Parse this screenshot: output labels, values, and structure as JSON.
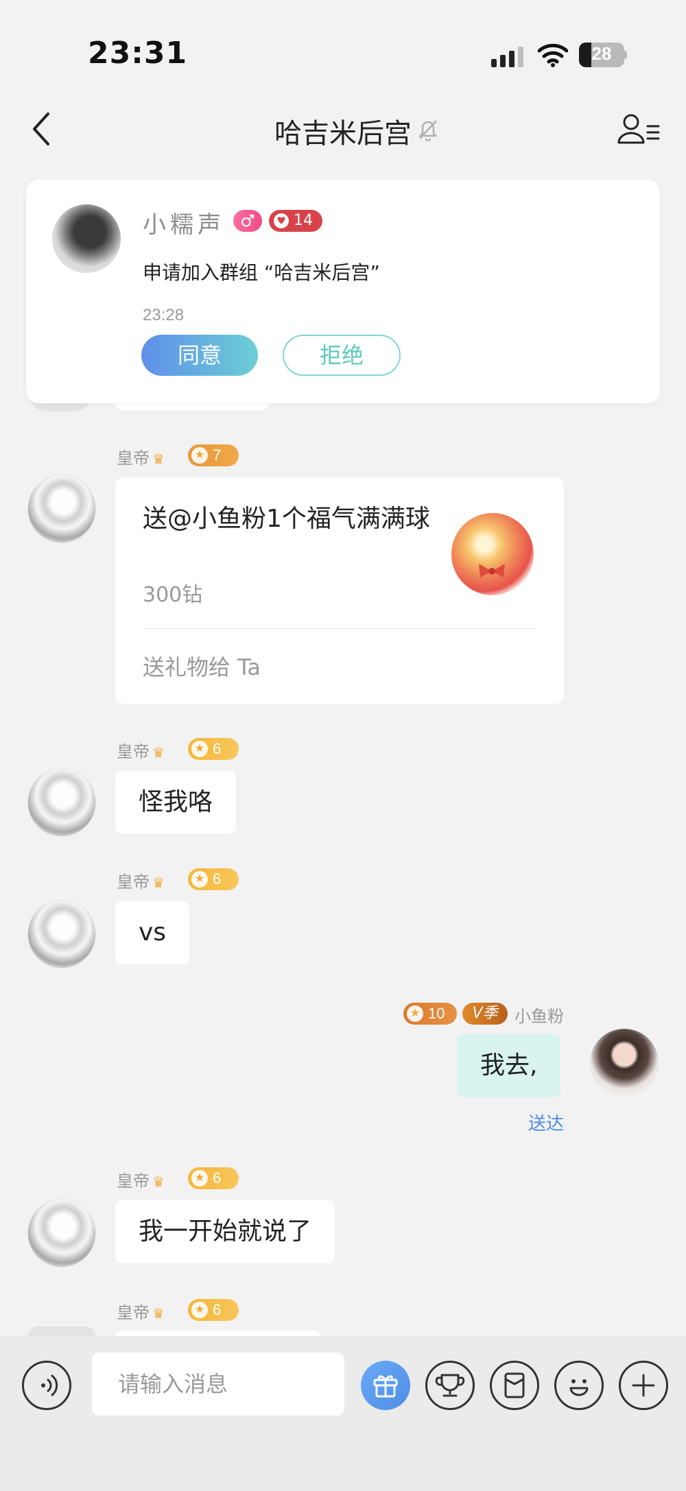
{
  "status_bar": {
    "time": "23:31",
    "battery": "28"
  },
  "nav": {
    "title": "哈吉米后宫"
  },
  "join_request": {
    "name": "小糯声",
    "gender_symbol": "♂",
    "heart_level": "14",
    "text": "申请加入群组 “哈吉米后宫”",
    "time": "23:28",
    "agree_label": "同意",
    "reject_label": "拒绝"
  },
  "messages": [
    {
      "sender": "皇帝",
      "level": "7",
      "type": "gift",
      "gift_text": "送@小鱼粉1个福气满满球",
      "gift_price": "300钻",
      "gift_action": "送礼物给 Ta"
    },
    {
      "sender": "皇帝",
      "level": "6",
      "text": "怪我咯"
    },
    {
      "sender": "皇帝",
      "level": "6",
      "text": "vs"
    },
    {
      "sender": "小鱼粉",
      "level": "10",
      "vip": "V季",
      "text": "我去,",
      "status": "送达"
    },
    {
      "sender": "皇帝",
      "level": "6",
      "text": "我一开始就说了"
    },
    {
      "sender": "皇帝",
      "level": "6"
    }
  ],
  "input": {
    "placeholder": "请输入消息"
  },
  "icons": {
    "back": "chevron-left-icon",
    "mute": "bell-off-icon",
    "members": "group-members-icon",
    "voice": "voice-icon",
    "gift": "gift-icon",
    "trophy": "trophy-icon",
    "envelope": "red-envelope-icon",
    "emoji": "emoji-icon",
    "plus": "plus-icon"
  },
  "colors": {
    "accent_blue": "#4d8ee6",
    "accent_teal": "#5cc9bc",
    "my_bubble": "#d9f3ef",
    "level_gold": "#f5b73a"
  }
}
